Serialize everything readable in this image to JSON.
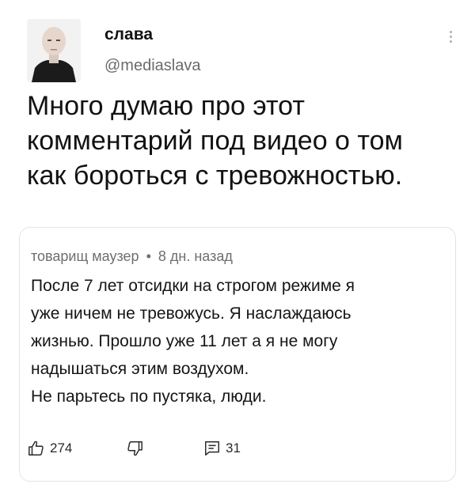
{
  "tweet": {
    "author": {
      "display_name": "слава",
      "handle": "@mediaslava",
      "avatar_icon": "avatar-photo"
    },
    "text": "Много думаю про этот\nкомментарий под видео о том\nкак бороться с тревожностью."
  },
  "comment": {
    "author": "товарищ маузер",
    "separator": "•",
    "time": "8 дн. назад",
    "text": "После 7 лет отсидки на строгом режиме я\nуже ничем не тревожусь. Я наслаждаюсь\nжизнью. Прошло уже 11 лет а я не могу\nнадышаться этим воздухом.\nНе парьтесь по пустяка, люди.",
    "actions": {
      "likes": "274",
      "replies": "31",
      "like_icon": "thumbs-up-icon",
      "dislike_icon": "thumbs-down-icon",
      "reply_icon": "comment-icon"
    }
  }
}
